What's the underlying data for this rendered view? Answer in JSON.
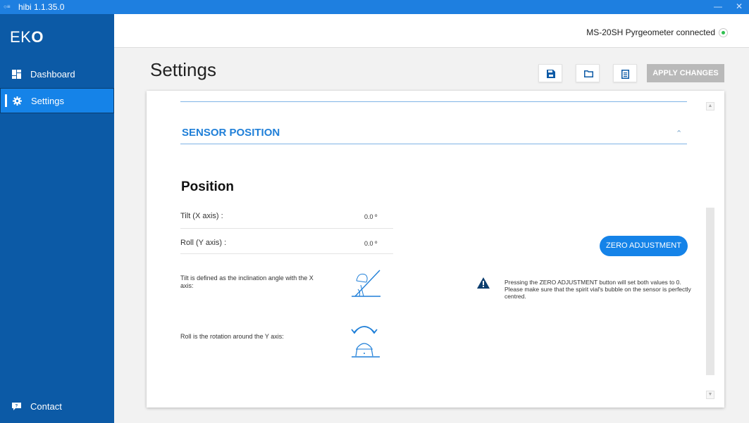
{
  "window": {
    "title": "hibi 1.1.35.0",
    "minimize": "—",
    "close": "✕"
  },
  "sidebar": {
    "logo_prefix": "EK",
    "logo_suffix": "O",
    "items": [
      {
        "label": "Dashboard",
        "icon": "dashboard-icon"
      },
      {
        "label": "Settings",
        "icon": "gear-icon"
      }
    ],
    "contact": {
      "label": "Contact",
      "icon": "chat-icon"
    }
  },
  "header": {
    "status_text": "MS-20SH Pyrgeometer connected",
    "status_color": "#2fbf4f"
  },
  "page": {
    "title": "Settings",
    "toolbar": {
      "save_icon": "save-icon",
      "open_icon": "folder-icon",
      "doc_icon": "document-icon",
      "apply_label": "APPLY CHANGES"
    }
  },
  "section": {
    "title": "SENSOR POSITION",
    "heading": "Position",
    "rows": [
      {
        "label": "Tilt  (X axis) :",
        "value": "0.0 º"
      },
      {
        "label": "Roll (Y axis) :",
        "value": "0.0 º"
      }
    ],
    "tilt_desc": "Tilt is defined as the inclination angle with the X axis:",
    "roll_desc": "Roll is the rotation around the Y axis:",
    "zero_button": "ZERO ADJUSTMENT",
    "warning": "Pressing the ZERO ADJUSTMENT button will set both values to 0.  Please make sure that the spirit vial's bubble on the sensor is perfectly centred."
  },
  "colors": {
    "accent": "#1583e8",
    "sidebar": "#0c5aa6",
    "titlebar": "#1e7fe0",
    "section_title": "#1f7fd8",
    "apply_disabled": "#b9b9b9"
  }
}
